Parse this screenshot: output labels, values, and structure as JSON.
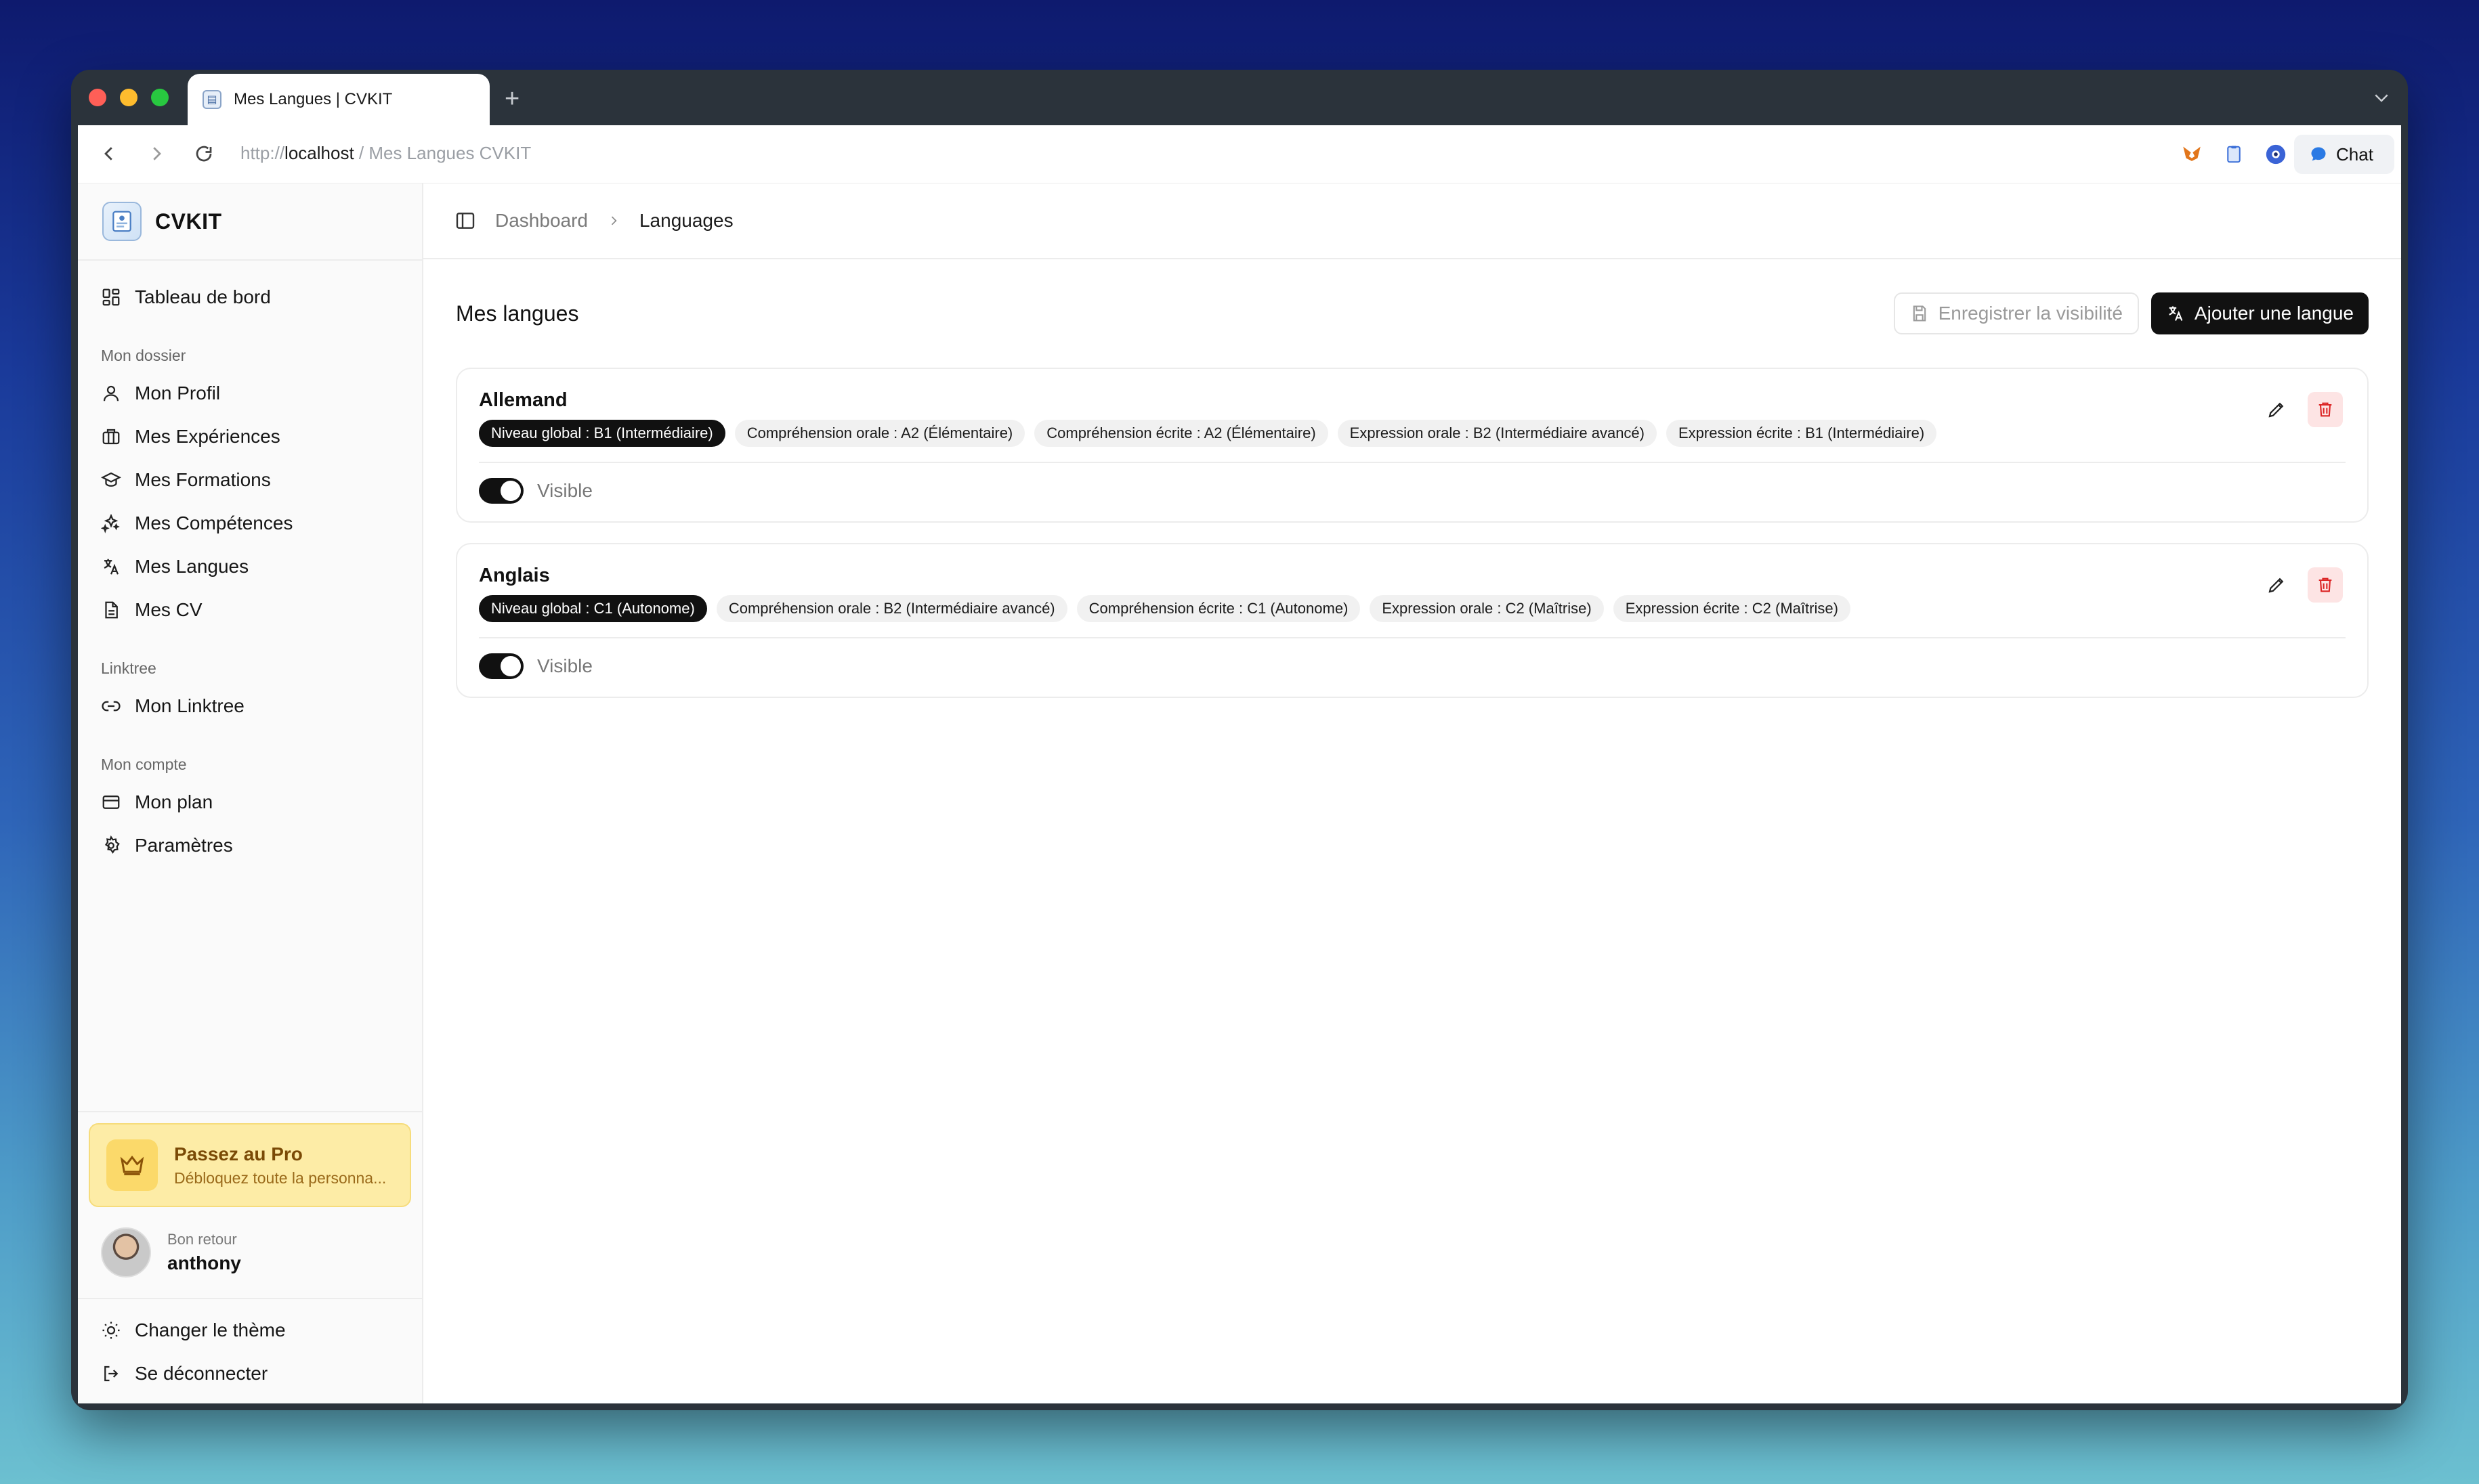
{
  "browser": {
    "tab_title": "Mes Langues | CVKIT",
    "url_scheme": "http://",
    "url_host": "localhost",
    "url_path": " / Mes Langues CVKIT",
    "chat_label": "Chat"
  },
  "sidebar": {
    "brand": "CVKIT",
    "dashboard": "Tableau de bord",
    "group_dossier": "Mon dossier",
    "dossier_items": [
      "Mon Profil",
      "Mes Expériences",
      "Mes Formations",
      "Mes Compétences",
      "Mes Langues",
      "Mes CV"
    ],
    "group_linktree": "Linktree",
    "linktree_item": "Mon Linktree",
    "group_compte": "Mon compte",
    "compte_items": [
      "Mon plan",
      "Paramètres"
    ],
    "pro_title": "Passez au Pro",
    "pro_subtitle": "Débloquez toute la personna...",
    "user_greeting": "Bon retour",
    "user_name": "anthony",
    "theme_label": "Changer le thème",
    "logout_label": "Se déconnecter"
  },
  "header": {
    "crumb_root": "Dashboard",
    "crumb_current": "Languages"
  },
  "main": {
    "title": "Mes langues",
    "save_visibility": "Enregistrer la visibilité",
    "add_language": "Ajouter une langue",
    "languages": [
      {
        "name": "Allemand",
        "badges": [
          "Niveau global : B1 (Intermédiaire)",
          "Compréhension orale : A2 (Élémentaire)",
          "Compréhension écrite : A2 (Élémentaire)",
          "Expression orale : B2 (Intermédiaire avancé)",
          "Expression écrite : B1 (Intermédiaire)"
        ],
        "visible_label": "Visible"
      },
      {
        "name": "Anglais",
        "badges": [
          "Niveau global : C1 (Autonome)",
          "Compréhension orale : B2 (Intermédiaire avancé)",
          "Compréhension écrite : C1 (Autonome)",
          "Expression orale : C2 (Maîtrise)",
          "Expression écrite : C2 (Maîtrise)"
        ],
        "visible_label": "Visible"
      }
    ]
  },
  "colors": {
    "primary": "#111111",
    "danger": "#dc2626",
    "pro_bg": "#fdeca6"
  }
}
